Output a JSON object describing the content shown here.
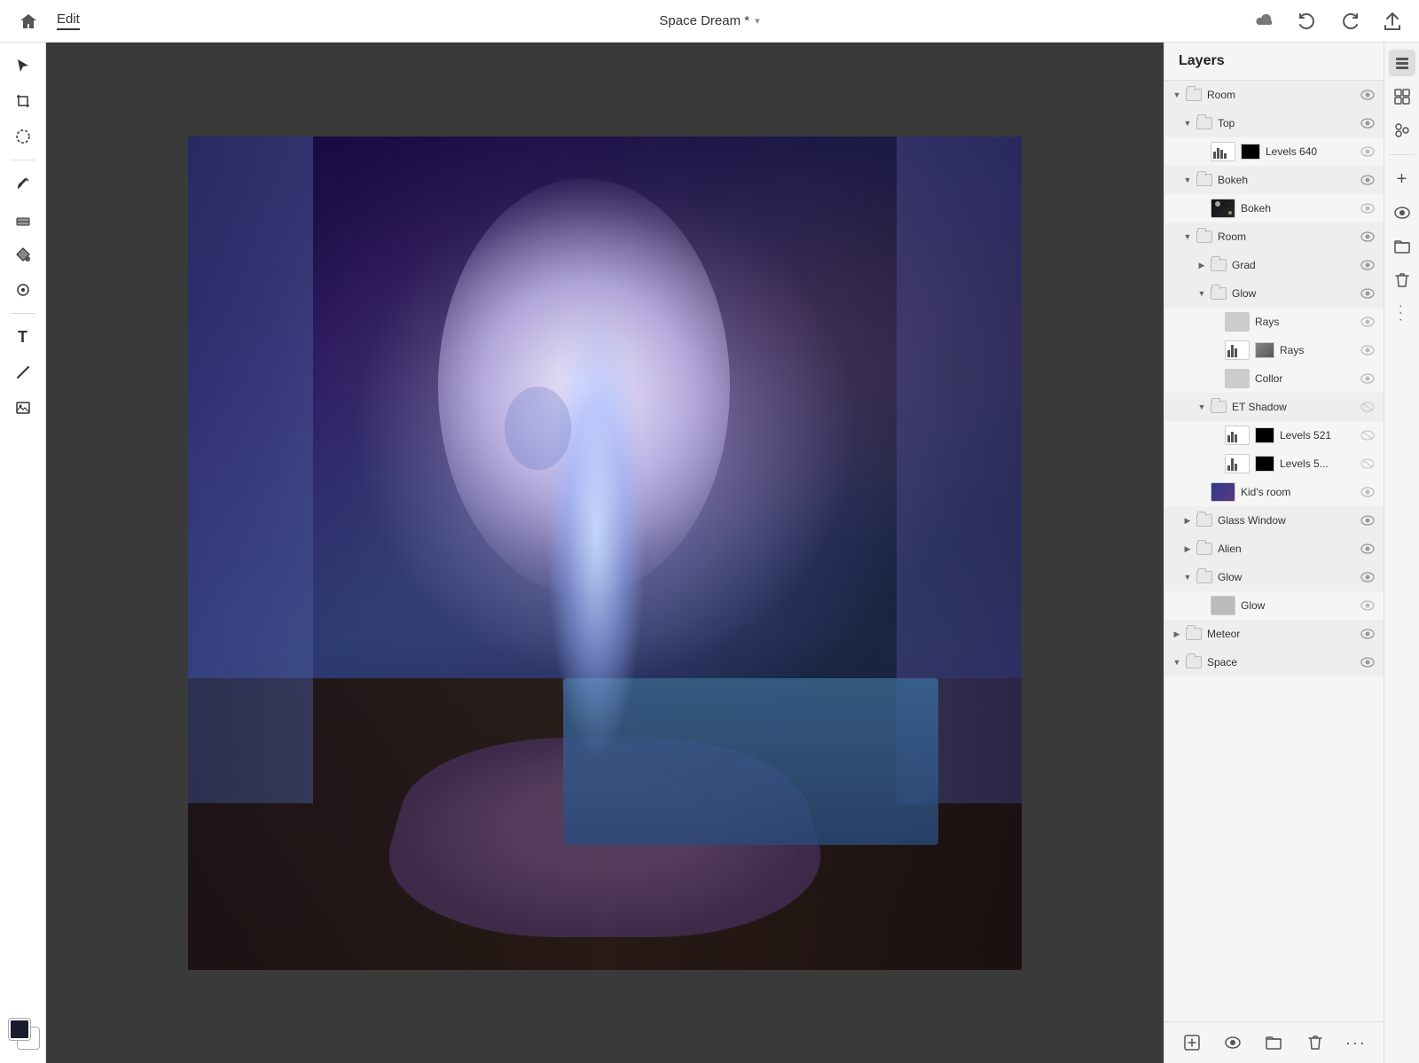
{
  "topbar": {
    "home_icon": "⌂",
    "edit_label": "Edit",
    "title": "Space Dream *",
    "title_arrow": "▾",
    "cloud_icon": "☁",
    "undo_icon": "↩",
    "redo_icon": "↪",
    "share_icon": "⬆"
  },
  "left_toolbar": {
    "tools": [
      {
        "id": "select",
        "icon": "▲",
        "active": false
      },
      {
        "id": "crop",
        "icon": "⊡",
        "active": false
      },
      {
        "id": "lasso",
        "icon": "◌",
        "active": false
      },
      {
        "id": "brush",
        "icon": "✏",
        "active": false
      },
      {
        "id": "eraser",
        "icon": "◫",
        "active": false
      },
      {
        "id": "fill",
        "icon": "◈",
        "active": false
      },
      {
        "id": "clone",
        "icon": "◎",
        "active": false
      },
      {
        "id": "text",
        "icon": "T",
        "active": false
      },
      {
        "id": "line",
        "icon": "╱",
        "active": false
      },
      {
        "id": "image",
        "icon": "▣",
        "active": false
      }
    ]
  },
  "layers_panel": {
    "title": "Layers",
    "items": [
      {
        "id": "room-group",
        "name": "Room",
        "type": "group",
        "indent": 0,
        "expanded": true,
        "visible": true,
        "has_toggle": true,
        "toggle_open": true
      },
      {
        "id": "top-group",
        "name": "Top",
        "type": "group",
        "indent": 1,
        "expanded": true,
        "visible": true,
        "has_toggle": true,
        "toggle_open": true
      },
      {
        "id": "levels640",
        "name": "Levels 640",
        "type": "adjustment",
        "indent": 2,
        "expanded": false,
        "visible": true,
        "has_toggle": false,
        "thumb": "histogram-black"
      },
      {
        "id": "bokeh-group",
        "name": "Bokeh",
        "type": "group",
        "indent": 1,
        "expanded": true,
        "visible": true,
        "has_toggle": true,
        "toggle_open": true
      },
      {
        "id": "bokeh-layer",
        "name": "Bokeh",
        "type": "layer",
        "indent": 2,
        "expanded": false,
        "visible": true,
        "has_toggle": false,
        "thumb": "bokeh"
      },
      {
        "id": "room-subgroup",
        "name": "Room",
        "type": "group",
        "indent": 1,
        "expanded": true,
        "visible": true,
        "has_toggle": true,
        "toggle_open": true
      },
      {
        "id": "grad-group",
        "name": "Grad",
        "type": "group",
        "indent": 2,
        "expanded": false,
        "visible": true,
        "has_toggle": true,
        "toggle_open": false
      },
      {
        "id": "glow-group",
        "name": "Glow",
        "type": "group",
        "indent": 2,
        "expanded": true,
        "visible": true,
        "has_toggle": true,
        "toggle_open": true
      },
      {
        "id": "rays-lightgray",
        "name": "Rays",
        "type": "layer",
        "indent": 3,
        "expanded": false,
        "visible": true,
        "has_toggle": false,
        "thumb": "lightgray"
      },
      {
        "id": "rays-layer",
        "name": "Rays",
        "type": "layer",
        "indent": 3,
        "expanded": false,
        "visible": true,
        "has_toggle": false,
        "thumb": "histogram-rays"
      },
      {
        "id": "collor-layer",
        "name": "Collor",
        "type": "layer",
        "indent": 3,
        "expanded": false,
        "visible": true,
        "has_toggle": false,
        "thumb": "lightgray"
      },
      {
        "id": "etshadow-group",
        "name": "ET Shadow",
        "type": "group",
        "indent": 2,
        "expanded": true,
        "visible": false,
        "has_toggle": true,
        "toggle_open": true
      },
      {
        "id": "levels521",
        "name": "Levels 521",
        "type": "adjustment",
        "indent": 3,
        "expanded": false,
        "visible": false,
        "has_toggle": false,
        "thumb": "histogram-black2"
      },
      {
        "id": "levels5",
        "name": "Levels 5...",
        "type": "adjustment",
        "indent": 3,
        "expanded": false,
        "visible": false,
        "has_toggle": false,
        "thumb": "histogram-black3"
      },
      {
        "id": "kidsroom-layer",
        "name": "Kid's room",
        "type": "layer",
        "indent": 2,
        "expanded": false,
        "visible": true,
        "has_toggle": false,
        "thumb": "scene"
      },
      {
        "id": "glasswindow-group",
        "name": "Glass Window",
        "type": "group",
        "indent": 1,
        "expanded": false,
        "visible": true,
        "has_toggle": true,
        "toggle_open": false
      },
      {
        "id": "alien-group",
        "name": "Alien",
        "type": "group",
        "indent": 1,
        "expanded": false,
        "visible": true,
        "has_toggle": true,
        "toggle_open": false
      },
      {
        "id": "glow-group2",
        "name": "Glow",
        "type": "group",
        "indent": 1,
        "expanded": true,
        "visible": true,
        "has_toggle": true,
        "toggle_open": true
      },
      {
        "id": "glow-layer2",
        "name": "Glow",
        "type": "layer",
        "indent": 2,
        "expanded": false,
        "visible": true,
        "has_toggle": false,
        "thumb": "glow"
      },
      {
        "id": "meteor-group",
        "name": "Meteor",
        "type": "group",
        "indent": 0,
        "expanded": false,
        "visible": true,
        "has_toggle": true,
        "toggle_open": false
      },
      {
        "id": "space-group",
        "name": "Space",
        "type": "group",
        "indent": 0,
        "expanded": true,
        "visible": true,
        "has_toggle": true,
        "toggle_open": true
      }
    ]
  },
  "right_mini_toolbar": {
    "icons": [
      {
        "id": "layers-icon",
        "icon": "⧉"
      },
      {
        "id": "effects-icon",
        "icon": "⊞"
      },
      {
        "id": "filters-icon",
        "icon": "☰"
      },
      {
        "id": "add-layer-icon",
        "icon": "+"
      },
      {
        "id": "eye-icon",
        "icon": "◉"
      },
      {
        "id": "folder-icon",
        "icon": "▣"
      },
      {
        "id": "delete-icon",
        "icon": "🗑"
      },
      {
        "id": "more-icon",
        "icon": "···"
      }
    ]
  },
  "colors": {
    "accent": "#4a90d9",
    "panel_bg": "#f5f5f5",
    "panel_border": "#ddd",
    "topbar_bg": "#ffffff",
    "selected_layer": "#e0e8f8"
  }
}
